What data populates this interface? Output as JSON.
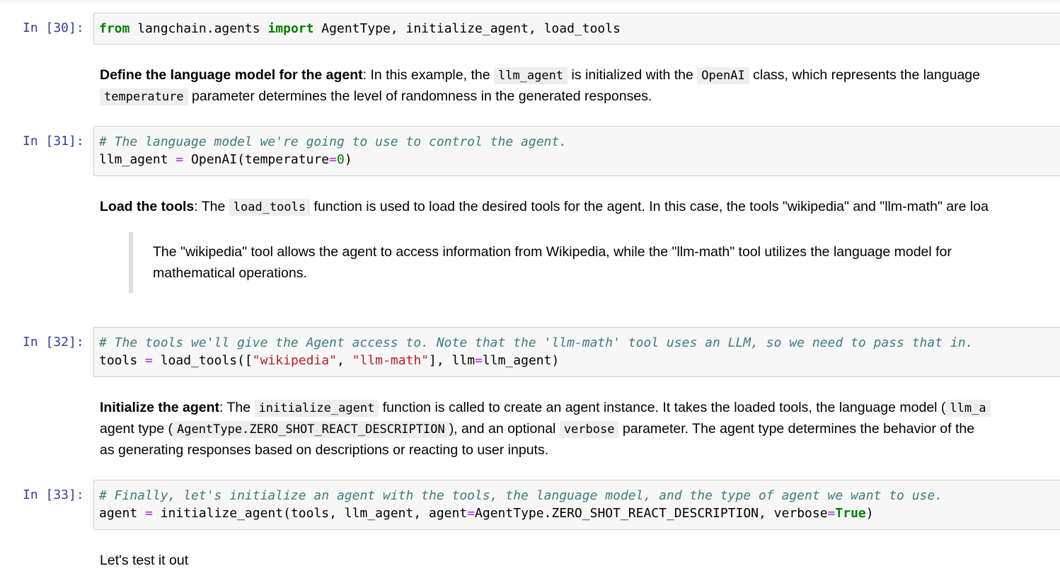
{
  "cells": {
    "c30": {
      "prompt": "In [30]:",
      "code": {
        "from": "from",
        "mod": " langchain.agents ",
        "imp": "import",
        "rest": " AgentType, initialize_agent, load_tools"
      }
    },
    "md1": {
      "bold": "Define the language model for the agent",
      "t1": ": In this example, the ",
      "code1": "llm_agent",
      "t2": " is initialized with the ",
      "code2": "OpenAI",
      "t3": " class, which represents the language ",
      "code3": "temperature",
      "t4": " parameter determines the level of randomness in the generated responses."
    },
    "c31": {
      "prompt": "In [31]:",
      "comment": "# The language model we're going to use to control the agent.",
      "l2a": "llm_agent ",
      "eq": "=",
      "l2b": " OpenAI(temperature",
      "eq2": "=",
      "zero": "0",
      "l2c": ")"
    },
    "md2": {
      "bold": "Load the tools",
      "t1": ": The ",
      "code1": "load_tools",
      "t2": " function is used to load the desired tools for the agent. In this case, the tools \"wikipedia\" and \"llm-math\" are loa",
      "quote_l1": "The \"wikipedia\" tool allows the agent to access information from Wikipedia, while the \"llm-math\" tool utilizes the language model for",
      "quote_l2": "mathematical operations."
    },
    "c32": {
      "prompt": "In [32]:",
      "comment": "# The tools we'll give the Agent access to. Note that the 'llm-math' tool uses an LLM, so we need to pass that in.",
      "a": "tools ",
      "eq": "=",
      "b": " load_tools([",
      "s1": "\"wikipedia\"",
      "c": ", ",
      "s2": "\"llm-math\"",
      "d": "], llm",
      "eq2": "=",
      "e": "llm_agent)"
    },
    "md3": {
      "bold": "Initialize the agent",
      "t1": ": The ",
      "code1": "initialize_agent",
      "t2": " function is called to create an agent instance. It takes the loaded tools, the language model (",
      "code2": "llm_a",
      "l2a": "agent type (",
      "code3": "AgentType.ZERO_SHOT_REACT_DESCRIPTION",
      "l2b": "), and an optional ",
      "code4": "verbose",
      "l2c": " parameter. The agent type determines the behavior of the",
      "l3": "as generating responses based on descriptions or reacting to user inputs."
    },
    "c33": {
      "prompt": "In [33]:",
      "comment": "# Finally, let's initialize an agent with the tools, the language model, and the type of agent we want to use.",
      "a": "agent ",
      "eq": "=",
      "b": " initialize_agent(tools, llm_agent, agent",
      "eq2": "=",
      "c": "AgentType.ZERO_SHOT_REACT_DESCRIPTION, verbose",
      "eq3": "=",
      "true": "True",
      "d": ")"
    },
    "md4": {
      "text": "Let's test it out"
    }
  },
  "colors": {
    "prompt": "#303f9f",
    "keyword": "#008000",
    "comment": "#3d7b7b",
    "string": "#ba2121",
    "operator": "#aa22ff"
  }
}
